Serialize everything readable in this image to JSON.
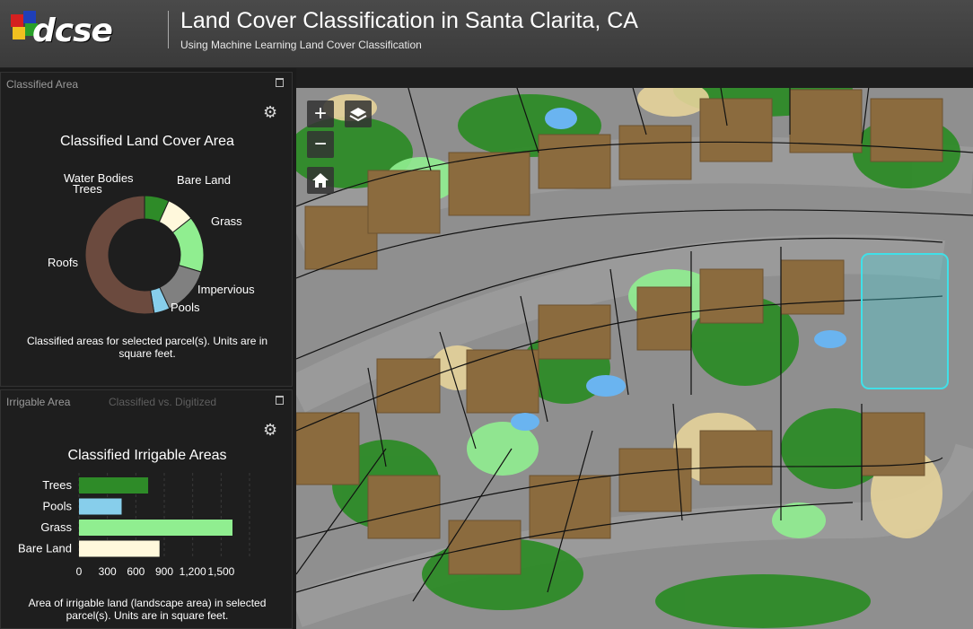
{
  "header": {
    "logo_text": "dcse",
    "title": "Land Cover Classification in Santa Clarita, CA",
    "subtitle": "Using Machine Learning Land Cover Classification"
  },
  "panel_top": {
    "tab": "Classified Area",
    "chart_title": "Classified Land Cover Area",
    "caption": "Classified areas for selected parcel(s). Units are in square feet."
  },
  "panel_bottom": {
    "tab_active": "Irrigable Area",
    "tab_inactive": "Classified vs. Digitized",
    "chart_title": "Classified Irrigable Areas",
    "caption": "Area of irrigable land (landscape area) in selected parcel(s). Units are in square feet."
  },
  "map": {
    "zoom_in_label": "+",
    "zoom_out_label": "−",
    "icons": [
      "layers-icon",
      "home-icon"
    ]
  },
  "colors": {
    "trees": "#2e8b28",
    "pools": "#87ceeb",
    "grass": "#90ee90",
    "bare_land": "#fff8dc",
    "impervious": "#808080",
    "roofs": "#6b4a3e",
    "water": "#1e90ff",
    "selection": "#40e0e8"
  },
  "chart_data": [
    {
      "type": "pie",
      "title": "Classified Land Cover Area",
      "labels": [
        "Water Bodies",
        "Trees",
        "Bare Land",
        "Grass",
        "Impervious",
        "Pools",
        "Roofs"
      ],
      "values": [
        2,
        700,
        800,
        1600,
        1400,
        450,
        5500
      ],
      "colors": [
        "#1e90ff",
        "#2e8b28",
        "#fff8dc",
        "#90ee90",
        "#808080",
        "#87ceeb",
        "#6b4a3e"
      ]
    },
    {
      "type": "bar",
      "title": "Classified Irrigable Areas",
      "categories": [
        "Trees",
        "Pools",
        "Grass",
        "Bare Land"
      ],
      "values": [
        730,
        450,
        1620,
        850
      ],
      "colors": [
        "#2e8b28",
        "#87ceeb",
        "#90ee90",
        "#fff8dc"
      ],
      "xticks": [
        "0",
        "300",
        "600",
        "900",
        "1,200",
        "1,500"
      ],
      "xlim": [
        0,
        1800
      ]
    }
  ]
}
